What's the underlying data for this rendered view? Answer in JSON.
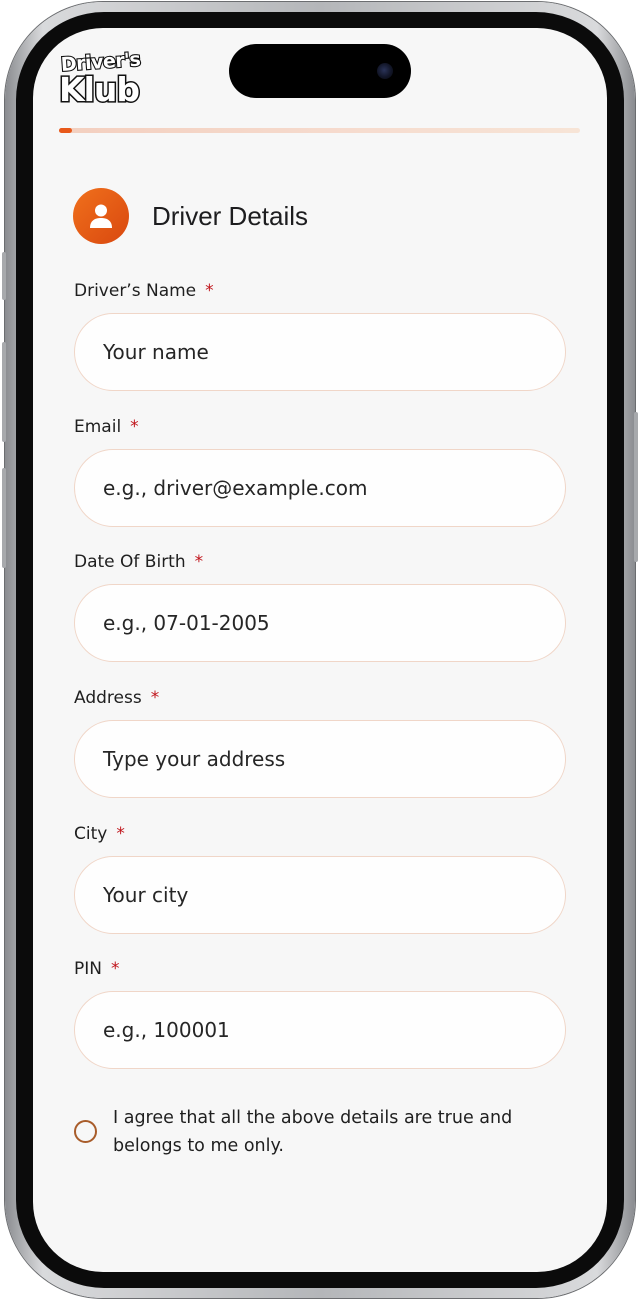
{
  "brand": {
    "logo_line1": "Driver's",
    "logo_line2": "Klub"
  },
  "progress": {
    "fraction": 0.025,
    "color": "#e8591a"
  },
  "section": {
    "title": "Driver Details",
    "icon": "user-icon"
  },
  "fields": [
    {
      "label": "Driver’s Name",
      "required_mark": "*",
      "placeholder": "Your name"
    },
    {
      "label": "Email",
      "required_mark": "*",
      "placeholder": "e.g., driver@example.com"
    },
    {
      "label": "Date Of Birth",
      "required_mark": "*",
      "placeholder": "e.g., 07-01-2005"
    },
    {
      "label": "Address",
      "required_mark": "*",
      "placeholder": "Type your address"
    },
    {
      "label": "City",
      "required_mark": "*",
      "placeholder": "Your city"
    },
    {
      "label": "PIN",
      "required_mark": "*",
      "placeholder": "e.g., 100001"
    }
  ],
  "consent": {
    "text": "I agree that all the above details are true and belongs to me only.",
    "checked": false
  },
  "colors": {
    "accent": "#e8591a",
    "required": "#c0141b",
    "input_border": "#f0d6c8"
  }
}
